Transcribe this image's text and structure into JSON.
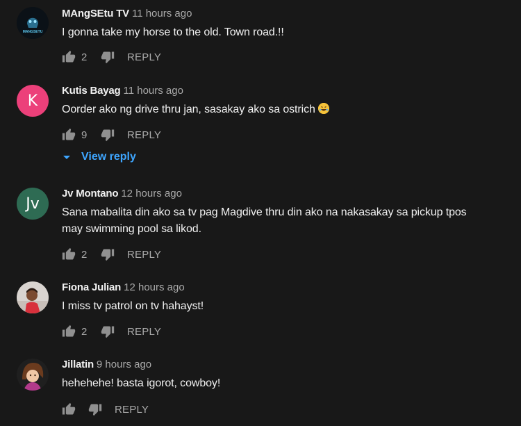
{
  "comments": [
    {
      "author": "MAngSEtu TV",
      "time": "11 hours ago",
      "text": "I gonna take my horse to the old. Town road.!!",
      "likes": "2",
      "reply_label": "REPLY",
      "avatar_text": "MANGSETU"
    },
    {
      "author": "Kutis Bayag",
      "time": "11 hours ago",
      "text": "Oorder ako ng drive thru jan, sasakay ako sa ostrich",
      "likes": "9",
      "reply_label": "REPLY",
      "avatar_letter": "K",
      "avatar_color": "#ec407a",
      "view_reply_label": "View reply"
    },
    {
      "author": "Jv Montano",
      "time": "12 hours ago",
      "text": "Sana mabalita din ako sa tv pag Magdive thru din ako na nakasakay sa pickup tpos may swimming pool sa likod.",
      "likes": "2",
      "reply_label": "REPLY",
      "avatar_letter": "Jv",
      "avatar_color": "#2e6b53"
    },
    {
      "author": "Fiona Julian",
      "time": "12 hours ago",
      "text": "I miss tv patrol on tv hahayst!",
      "likes": "2",
      "reply_label": "REPLY"
    },
    {
      "author": "Jillatin",
      "time": "9 hours ago",
      "text": "hehehehe! basta igorot, cowboy!",
      "likes": "",
      "reply_label": "REPLY"
    }
  ],
  "colors": {
    "background": "#181818",
    "link": "#3ea6ff",
    "muted": "#aaaaaa"
  },
  "icons": {
    "like": "thumbs-up-icon",
    "dislike": "thumbs-down-icon",
    "expand": "caret-down-icon",
    "emoji": "rolling-laughing-emoji"
  }
}
